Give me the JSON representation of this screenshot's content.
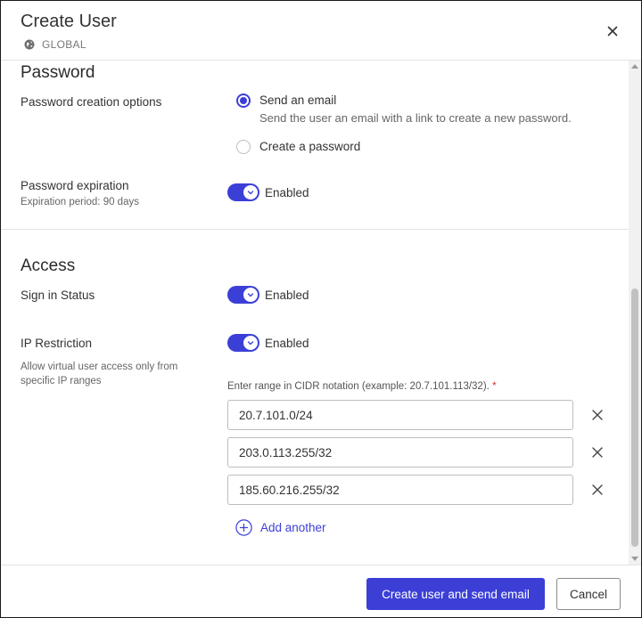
{
  "dialog": {
    "title": "Create User",
    "scope_label": "GLOBAL",
    "scope_icon": "globe-icon",
    "close_icon": "close-icon"
  },
  "password_section": {
    "title": "Password",
    "creation_label": "Password creation options",
    "options": [
      {
        "label": "Send an email",
        "description": "Send the user an email with a link to create a new password.",
        "selected": true
      },
      {
        "label": "Create a password",
        "selected": false
      }
    ],
    "expiration_label": "Password expiration",
    "expiration_help": "Expiration period: 90 days",
    "expiration_toggle": {
      "on": true,
      "label": "Enabled"
    }
  },
  "access_section": {
    "title": "Access",
    "sign_in_label": "Sign in Status",
    "sign_in_toggle": {
      "on": true,
      "label": "Enabled"
    },
    "ip_label": "IP Restriction",
    "ip_help": "Allow virtual user access only from specific IP ranges",
    "ip_toggle": {
      "on": true,
      "label": "Enabled"
    },
    "cidr_hint": "Enter range in CIDR notation (example: 20.7.101.113/32).",
    "required_marker": "*",
    "ip_ranges": [
      "20.7.101.0/24",
      "203.0.113.255/32",
      "185.60.216.255/32"
    ],
    "add_another_label": "Add another"
  },
  "footer": {
    "primary_label": "Create user and send email",
    "cancel_label": "Cancel"
  },
  "colors": {
    "accent": "#3b3fd6",
    "required": "#d0312d"
  }
}
